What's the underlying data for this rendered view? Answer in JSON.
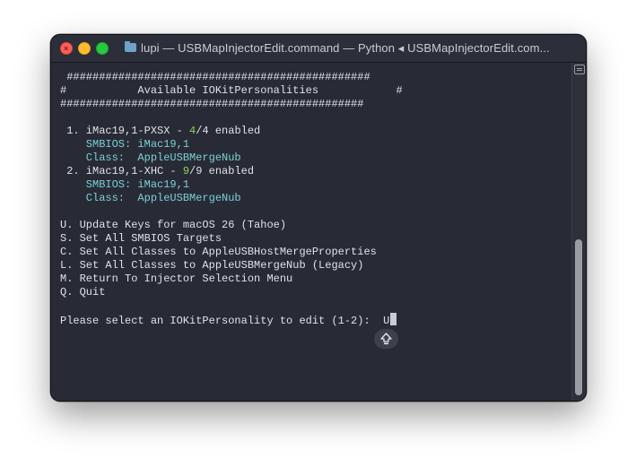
{
  "window": {
    "title": "lupi — USBMapInjectorEdit.command — Python ◂ USBMapInjectorEdit.com..."
  },
  "terminal": {
    "header_top": " ###############################################",
    "header_mid": "#           Available IOKitPersonalities            #",
    "header_bottom": "###############################################",
    "entries": [
      {
        "prefix": " 1. iMac19,1-PXSX - ",
        "enabled_count": "4",
        "total_suffix": "/4 enabled",
        "smbios": "    SMBIOS: iMac19,1",
        "class": "    Class:  AppleUSBMergeNub"
      },
      {
        "prefix": " 2. iMac19,1-XHC - ",
        "enabled_count": "9",
        "total_suffix": "/9 enabled",
        "smbios": "    SMBIOS: iMac19,1",
        "class": "    Class:  AppleUSBMergeNub"
      }
    ],
    "menu": [
      "U. Update Keys for macOS 26 (Tahoe)",
      "S. Set All SMBIOS Targets",
      "C. Set All Classes to AppleUSBHostMergeProperties",
      "L. Set All Classes to AppleUSBMergeNub (Legacy)",
      "M. Return To Injector Selection Menu",
      "Q. Quit"
    ],
    "prompt": "Please select an IOKitPersonality to edit (1-2):  ",
    "input_value": "U"
  },
  "icons": {
    "close": "close-icon",
    "minimize": "minimize-icon",
    "maximize": "maximize-icon",
    "folder": "folder-icon",
    "shift": "caps-lock-shift-icon"
  },
  "colors": {
    "terminal_background": "#282b36",
    "text": "#dfe1e6",
    "accent_cyan": "#7ad0d4",
    "accent_green": "#8fd15c"
  }
}
